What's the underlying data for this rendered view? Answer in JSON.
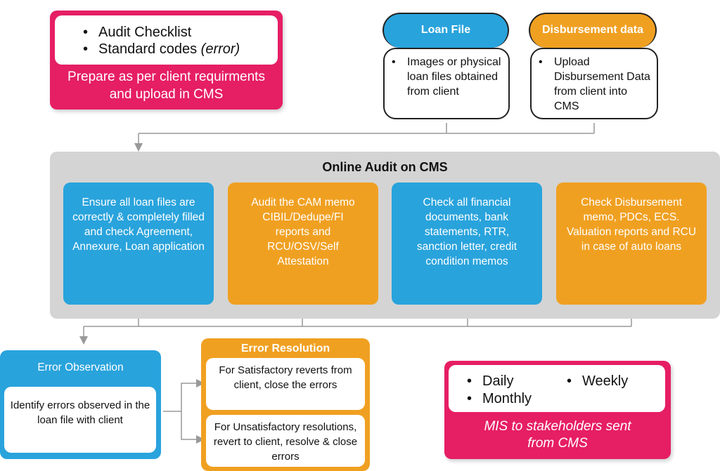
{
  "prepare": {
    "items": [
      "Audit Checklist",
      "Standard codes"
    ],
    "item2_suffix": "(error)",
    "caption": "Prepare as per client requirments and upload in CMS"
  },
  "loan_file": {
    "title": "Loan File",
    "bullet": "Images or physical loan files obtained from client"
  },
  "disbursement": {
    "title": "Disbursement data",
    "bullet": "Upload Disbursement Data from client into CMS"
  },
  "online_audit": {
    "title": "Online Audit on CMS",
    "steps": [
      "Ensure all loan files are correctly & completely filled and check Agreement, Annexure, Loan application",
      "Audit the CAM memo CIBIL/Dedupe/FI reports and RCU/OSV/Self Attestation",
      "Check all financial documents, bank statements, RTR, sanction letter, credit condition memos",
      "Check Disbursement memo, PDCs, ECS. Valuation reports and RCU in case of auto loans"
    ]
  },
  "error_observation": {
    "title": "Error Observation",
    "body": "Identify errors observed in the loan file with client"
  },
  "error_resolution": {
    "title": "Error Resolution",
    "satisfactory": "For Satisfactory reverts from client, close the errors",
    "unsatisfactory": "For Unsatisfactory resolutions, revert to client, resolve & close errors"
  },
  "mis": {
    "items": [
      "Daily",
      "Weekly",
      "Monthly"
    ],
    "caption": "MIS to stakeholders sent from CMS"
  },
  "colors": {
    "pink": "#e61e64",
    "blue": "#29a3dc",
    "orange": "#f0a021",
    "gray_panel": "#d4d4d4",
    "connector": "#999999"
  }
}
